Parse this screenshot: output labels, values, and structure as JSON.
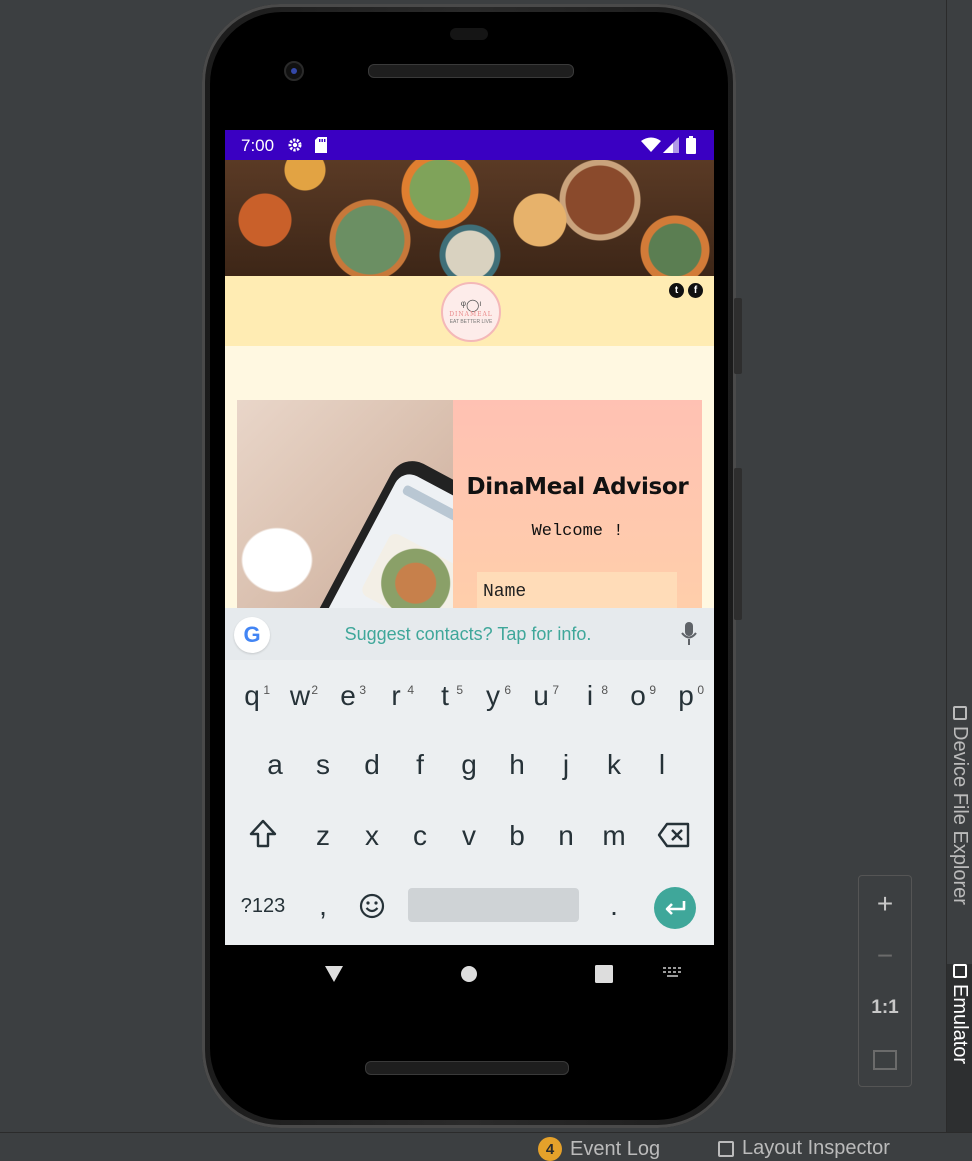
{
  "ide": {
    "side_tabs": [
      "Device File Explorer",
      "Emulator"
    ],
    "zoom": {
      "plus": "+",
      "minus": "−",
      "one_to_one": "1:1"
    },
    "bottom_bar": {
      "event_log_count": "4",
      "event_log_label": "Event Log",
      "layout_inspector_label": "Layout Inspector"
    }
  },
  "device": {
    "status_time": "7:00",
    "app": {
      "logo_name": "DINAMEAL",
      "logo_tagline": "EAT BETTER LIVE",
      "social": [
        "twitter-icon",
        "facebook-icon"
      ],
      "title": "DinaMeal Advisor",
      "welcome": "Welcome !",
      "name_placeholder": "Name"
    },
    "keyboard": {
      "suggestion": "Suggest contacts? Tap for info.",
      "row1": [
        "q",
        "w",
        "e",
        "r",
        "t",
        "y",
        "u",
        "i",
        "o",
        "p"
      ],
      "row1_hints": [
        "1",
        "2",
        "3",
        "4",
        "5",
        "6",
        "7",
        "8",
        "9",
        "0"
      ],
      "row2": [
        "a",
        "s",
        "d",
        "f",
        "g",
        "h",
        "j",
        "k",
        "l"
      ],
      "row3": [
        "z",
        "x",
        "c",
        "v",
        "b",
        "n",
        "m"
      ],
      "symbols_key": "?123",
      "comma_key": ",",
      "period_key": "."
    },
    "accent_color": "#3fa79a",
    "statusbar_color": "#3a00c2"
  }
}
